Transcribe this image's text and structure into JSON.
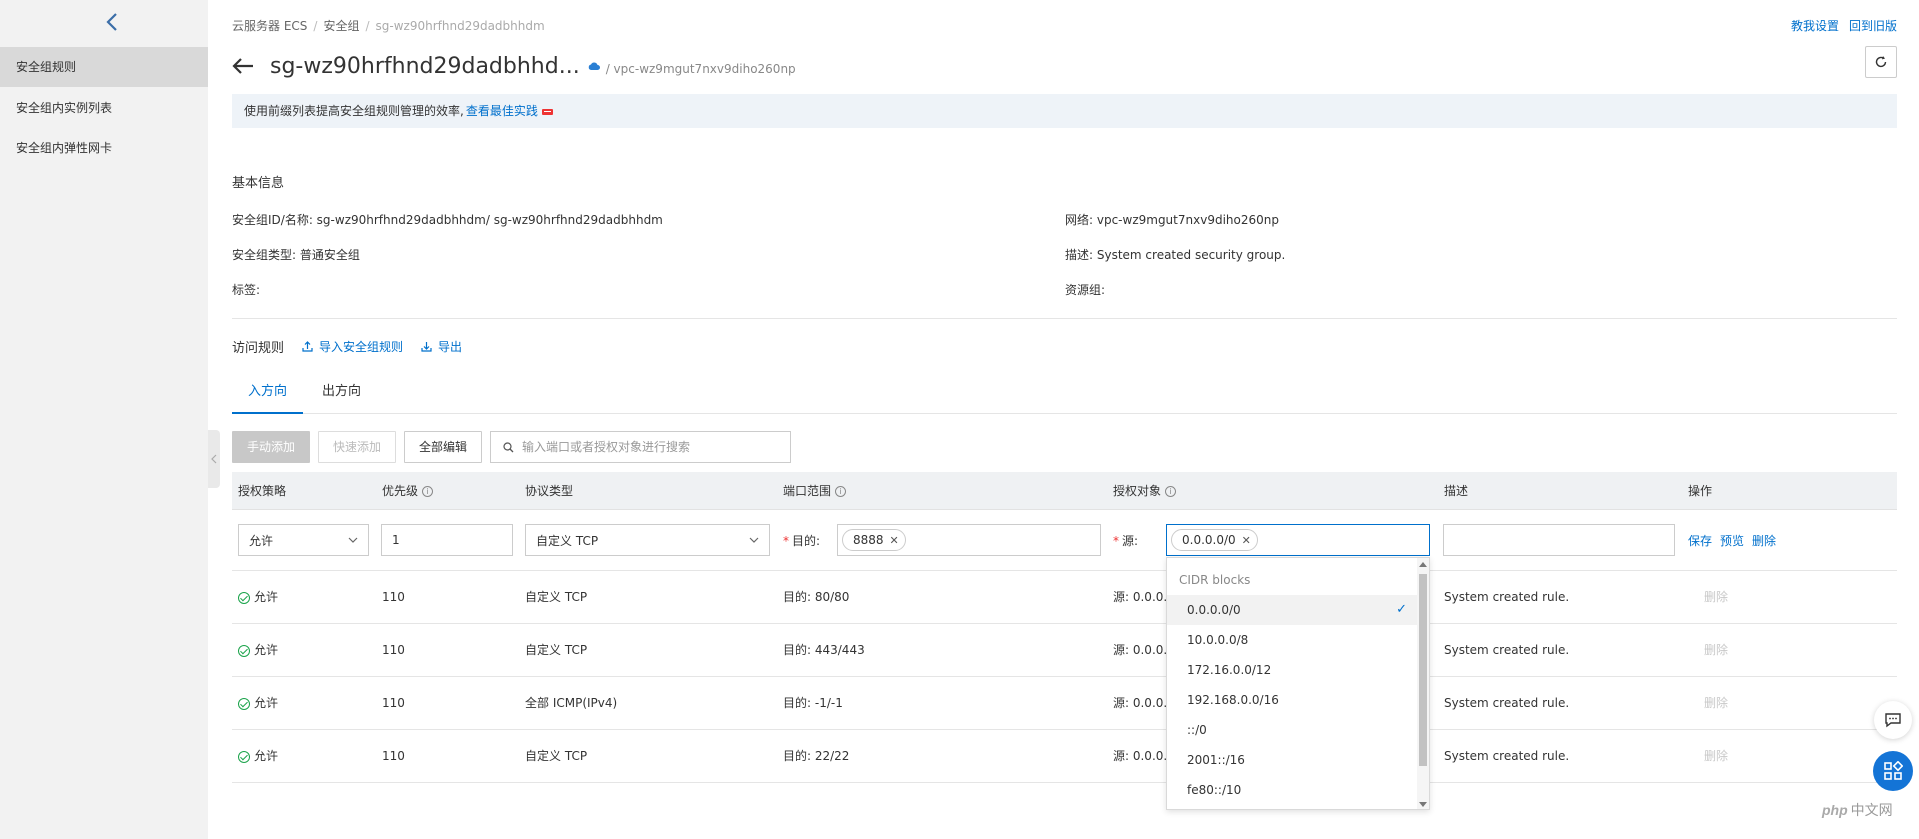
{
  "sidebar": {
    "items": [
      {
        "label": "安全组规则",
        "active": true
      },
      {
        "label": "安全组内实例列表",
        "active": false
      },
      {
        "label": "安全组内弹性网卡",
        "active": false
      }
    ]
  },
  "breadcrumb": [
    "云服务器 ECS",
    "安全组",
    "sg-wz90hrfhnd29dadbhhdm"
  ],
  "top_links": [
    "教我设置",
    "回到旧版"
  ],
  "title": "sg-wz90hrfhnd29dadbhhd...",
  "vpc_subtitle": "/ vpc-wz9mgut7nxv9diho260np",
  "banner": {
    "text": "使用前缀列表提高安全组规则管理的效率,",
    "link": "查看最佳实践"
  },
  "basic_info": {
    "section_title": "基本信息",
    "id_name": "安全组ID/名称:  sg-wz90hrfhnd29dadbhhdm/ sg-wz90hrfhnd29dadbhhdm",
    "type": "安全组类型:  普通安全组",
    "tags": "标签:",
    "network": "网络:  vpc-wz9mgut7nxv9diho260np",
    "description": "描述:  System created security group.",
    "resource_group": "资源组:"
  },
  "rules": {
    "title": "访问规则",
    "import_label": "导入安全组规则",
    "export_label": "导出"
  },
  "tabs": [
    "入方向",
    "出方向"
  ],
  "toolbar": {
    "manual_add": "手动添加",
    "quick_add": "快速添加",
    "edit_all": "全部编辑",
    "search_placeholder": "输入端口或者授权对象进行搜索"
  },
  "table": {
    "headers": [
      "授权策略",
      "优先级",
      "协议类型",
      "端口范围",
      "授权对象",
      "描述",
      "操作"
    ],
    "edit_row": {
      "policy": "允许",
      "priority": "1",
      "protocol": "自定义 TCP",
      "dest_label": "目的:",
      "dest_tag": "8888",
      "source_label": "源:",
      "source_tag": "0.0.0.0/0",
      "description": "",
      "ops": [
        "保存",
        "预览",
        "删除"
      ]
    },
    "rows": [
      {
        "policy": "允许",
        "priority": "110",
        "protocol": "自定义 TCP",
        "port": "目的: 80/80",
        "source": "源: 0.0.0.0",
        "desc": "System created rule.",
        "op": "删除"
      },
      {
        "policy": "允许",
        "priority": "110",
        "protocol": "自定义 TCP",
        "port": "目的: 443/443",
        "source": "源: 0.0.0.0",
        "desc": "System created rule.",
        "op": "删除"
      },
      {
        "policy": "允许",
        "priority": "110",
        "protocol": "全部 ICMP(IPv4)",
        "port": "目的: -1/-1",
        "source": "源: 0.0.0.0",
        "desc": "System created rule.",
        "op": "删除"
      },
      {
        "policy": "允许",
        "priority": "110",
        "protocol": "自定义 TCP",
        "port": "目的: 22/22",
        "source": "源: 0.0.0.0",
        "desc": "System created rule.",
        "op": "删除"
      }
    ]
  },
  "dropdown": {
    "group": "CIDR blocks",
    "options": [
      "0.0.0.0/0",
      "10.0.0.0/8",
      "172.16.0.0/12",
      "192.168.0.0/16",
      "::/0",
      "2001::/16",
      "fe80::/10"
    ],
    "selected": "0.0.0.0/0"
  },
  "watermark": {
    "brand": "php",
    "text": "中文网"
  },
  "colors": {
    "accent": "#0070cc",
    "required": "#ee3333",
    "success": "#1aa34a",
    "banner_bg": "#eef3f8"
  }
}
